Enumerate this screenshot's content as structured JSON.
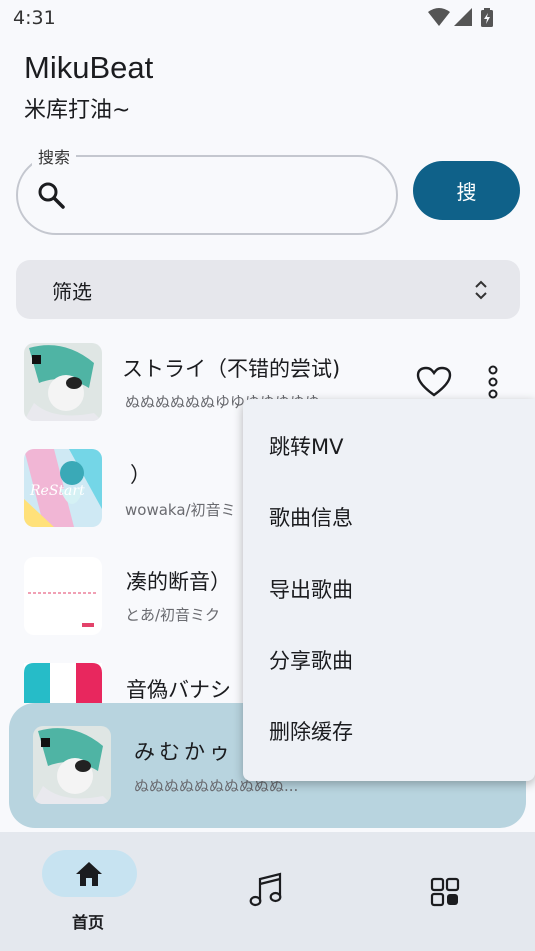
{
  "status_bar": {
    "time": "4:31",
    "icons": [
      "wifi-icon",
      "signal-icon",
      "battery-icon"
    ]
  },
  "header": {
    "title": "MikuBeat",
    "subtitle": "米库打油~"
  },
  "search": {
    "label": "搜索",
    "placeholder": "",
    "value": "",
    "button_label": "搜"
  },
  "filter": {
    "label": "筛选"
  },
  "songs": [
    {
      "title": "ストライ（不错的尝试)",
      "artist": "ぬぬぬぬぬぬゆゆゆゆゆゆゆ"
    },
    {
      "title": "）",
      "artist": "wowaka/初音ミ"
    },
    {
      "title": "凑的断音）",
      "artist": "とあ/初音ミク"
    },
    {
      "title": "音偽バナシ",
      "artist": ""
    }
  ],
  "now_playing": {
    "title": "みむかゥ",
    "artist": "ぬぬぬぬぬぬぬぬぬぬ..."
  },
  "menu": {
    "items": [
      "跳转MV",
      "歌曲信息",
      "导出歌曲",
      "分享歌曲",
      "删除缓存"
    ]
  },
  "nav": {
    "home_label": "首页"
  },
  "colors": {
    "accent": "#0f6189",
    "now_playing_bg": "#b8d4df",
    "nav_pill": "#c7e3f1"
  }
}
